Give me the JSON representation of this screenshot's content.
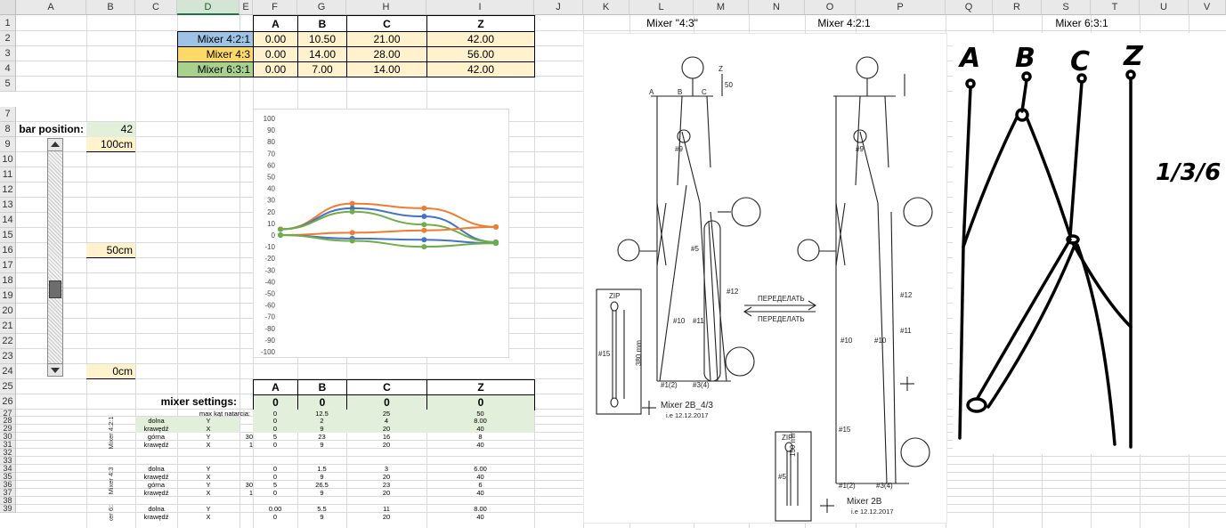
{
  "columns": [
    "A",
    "B",
    "C",
    "D",
    "E",
    "F",
    "G",
    "H",
    "I",
    "J",
    "K",
    "L",
    "M",
    "N",
    "O",
    "P",
    "Q",
    "R",
    "S",
    "T",
    "U",
    "V"
  ],
  "rows": [
    "1",
    "2",
    "3",
    "4",
    "5",
    "7",
    "8",
    "9",
    "10",
    "11",
    "12",
    "13",
    "14",
    "15",
    "16",
    "17",
    "18",
    "19",
    "20",
    "21",
    "22",
    "23",
    "24",
    "25",
    "26",
    "27",
    "28",
    "29",
    "30",
    "31",
    "32",
    "33",
    "34",
    "35",
    "36",
    "37",
    "38",
    "39"
  ],
  "top_table": {
    "headers": [
      "A",
      "B",
      "C",
      "Z"
    ],
    "rows": [
      {
        "label": "Mixer 4:2:1",
        "values": [
          "0.00",
          "10.50",
          "21.00",
          "42.00"
        ],
        "color": "#9dc3e6"
      },
      {
        "label": "Mixer 4:3",
        "values": [
          "0.00",
          "14.00",
          "28.00",
          "56.00"
        ],
        "color": "#ffd966"
      },
      {
        "label": "Mixer 6:3:1",
        "values": [
          "0.00",
          "7.00",
          "14.00",
          "42.00"
        ],
        "color": "#a9d18e"
      }
    ]
  },
  "bar": {
    "label": "bar position:",
    "value": "42",
    "mark_top": "100cm",
    "mark_mid": "50cm",
    "mark_bot": "0cm",
    "level": 0.42
  },
  "chart_data": {
    "type": "line",
    "ylim": [
      -100,
      100
    ],
    "yticks": [
      "100",
      "90",
      "80",
      "70",
      "60",
      "50",
      "40",
      "30",
      "20",
      "10",
      "0",
      "-10",
      "-20",
      "-30",
      "-40",
      "-50",
      "-60",
      "-70",
      "-80",
      "-90",
      "-100"
    ],
    "x": [
      0,
      1,
      2,
      3
    ],
    "series": [
      {
        "color": "#ed7d31",
        "values": [
          5,
          27,
          23,
          7
        ]
      },
      {
        "color": "#4472c4",
        "values": [
          5,
          23,
          16,
          -6
        ]
      },
      {
        "color": "#70ad47",
        "values": [
          5,
          20,
          9,
          -6
        ]
      },
      {
        "color": "#ed7d31",
        "values": [
          0,
          2,
          4,
          7
        ]
      },
      {
        "color": "#4472c4",
        "values": [
          0,
          -3,
          -4,
          -7
        ]
      },
      {
        "color": "#70ad47",
        "values": [
          0,
          -5,
          -10,
          -7
        ]
      }
    ]
  },
  "settings": {
    "headers": [
      "A",
      "B",
      "C",
      "Z"
    ],
    "label": "mixer settings:",
    "values": [
      "0",
      "0",
      "0",
      "0"
    ],
    "max_angle_label": "max kąt natarcia:",
    "max_angle": [
      "0",
      "12.5",
      "25",
      "50"
    ]
  },
  "groups": [
    {
      "name": "Mixer 4:2:1",
      "rows": [
        {
          "c": "dolna",
          "d": "Y",
          "e": "",
          "f": "0",
          "g": "2",
          "h": "4",
          "i": "8.00"
        },
        {
          "c": "krawędź",
          "d": "X",
          "e": "",
          "f": "0",
          "g": "9",
          "h": "20",
          "i": "40"
        },
        {
          "c": "górna",
          "d": "Y",
          "e": "30",
          "f": "5",
          "g": "23",
          "h": "16",
          "i": "8"
        },
        {
          "c": "krawędź",
          "d": "X",
          "e": "1",
          "f": "0",
          "g": "9",
          "h": "20",
          "i": "40"
        }
      ]
    },
    {
      "name": "Mixer 4:3",
      "rows": [
        {
          "c": "dolna",
          "d": "Y",
          "e": "",
          "f": "0",
          "g": "1.5",
          "h": "3",
          "i": "6.00"
        },
        {
          "c": "krawędź",
          "d": "X",
          "e": "",
          "f": "0",
          "g": "9",
          "h": "20",
          "i": "40"
        },
        {
          "c": "górna",
          "d": "Y",
          "e": "30",
          "f": "5",
          "g": "26.5",
          "h": "23",
          "i": "6"
        },
        {
          "c": "krawędź",
          "d": "X",
          "e": "1",
          "f": "0",
          "g": "9",
          "h": "20",
          "i": "40"
        }
      ]
    },
    {
      "name": "Mixer 6:3:1",
      "rows": [
        {
          "c": "dolna",
          "d": "Y",
          "e": "",
          "f": "0.00",
          "g": "5.5",
          "h": "11",
          "i": "8.00"
        },
        {
          "c": "krawędź",
          "d": "X",
          "e": "",
          "f": "0",
          "g": "9",
          "h": "20",
          "i": "40"
        }
      ]
    }
  ],
  "labels": {
    "mixer43": "Mixer \"4:3\"",
    "mixer421": "Mixer 4:2:1",
    "mixer631": "Mixer 6:3:1"
  },
  "diagram": {
    "arrow_text": "ПЕРЕДЕЛАТЬ",
    "zip": "ZIP",
    "mm_left": "380 mm",
    "mm_right": "150 mm",
    "title_left": "Mixer 2B_4/3",
    "date_left": "i.e 12.12.2017",
    "title_right": "Mixer 2B",
    "date_right": "i.e 12.12.2017",
    "tag_a": "A",
    "tag_b": "B",
    "tag_c": "C",
    "tag_z": "Z",
    "n9": "#9",
    "n5": "#5",
    "n10": "#10",
    "n11": "#11",
    "n12": "#12",
    "n15": "#15",
    "n1": "#1(2)",
    "n3": "#3(4)",
    "dim50": "50"
  },
  "sketch": {
    "a": "A",
    "b": "B",
    "c": "C",
    "z": "Z",
    "ratio": "1/3/6"
  }
}
